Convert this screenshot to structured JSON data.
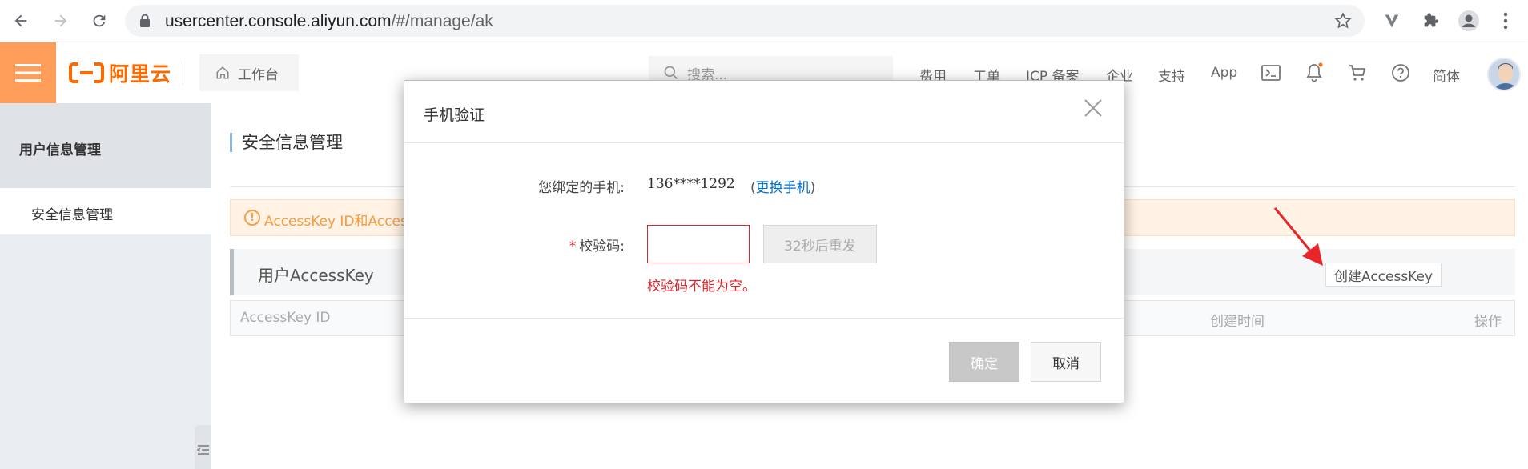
{
  "browser": {
    "url_host": "usercenter.console.aliyun.com",
    "url_path": "/#/manage/ak"
  },
  "topbar": {
    "logo_text": "阿里云",
    "workbench_label": "工作台",
    "search_placeholder": "搜索...",
    "links": [
      "费用",
      "工单",
      "ICP 备案",
      "企业",
      "支持",
      "App"
    ],
    "lang_label": "简体",
    "notification_dot_color": "#ff6a00"
  },
  "sidebar": {
    "title": "用户信息管理",
    "items": [
      {
        "label": "安全信息管理"
      }
    ]
  },
  "main": {
    "page_title": "安全信息管理",
    "notice_text": "AccessKey ID和Access",
    "section_title": "用户AccessKey",
    "create_button": "创建AccessKey",
    "columns": [
      "AccessKey ID",
      "创建时间",
      "操作"
    ]
  },
  "modal": {
    "title": "手机验证",
    "phone_label": "您绑定的手机:",
    "phone_value": "136****1292",
    "change_phone_open": "(",
    "change_phone_link": "更换手机",
    "change_phone_close": ")",
    "required_mark": "*",
    "code_label": "校验码:",
    "code_value": "",
    "resend_label": "32秒后重发",
    "error_text": "校验码不能为空。",
    "ok_label": "确定",
    "cancel_label": "取消"
  },
  "colors": {
    "brand": "#ff6a00",
    "error": "#e0252b",
    "link": "#0070cc",
    "annotation_arrow": "#e8262a"
  }
}
